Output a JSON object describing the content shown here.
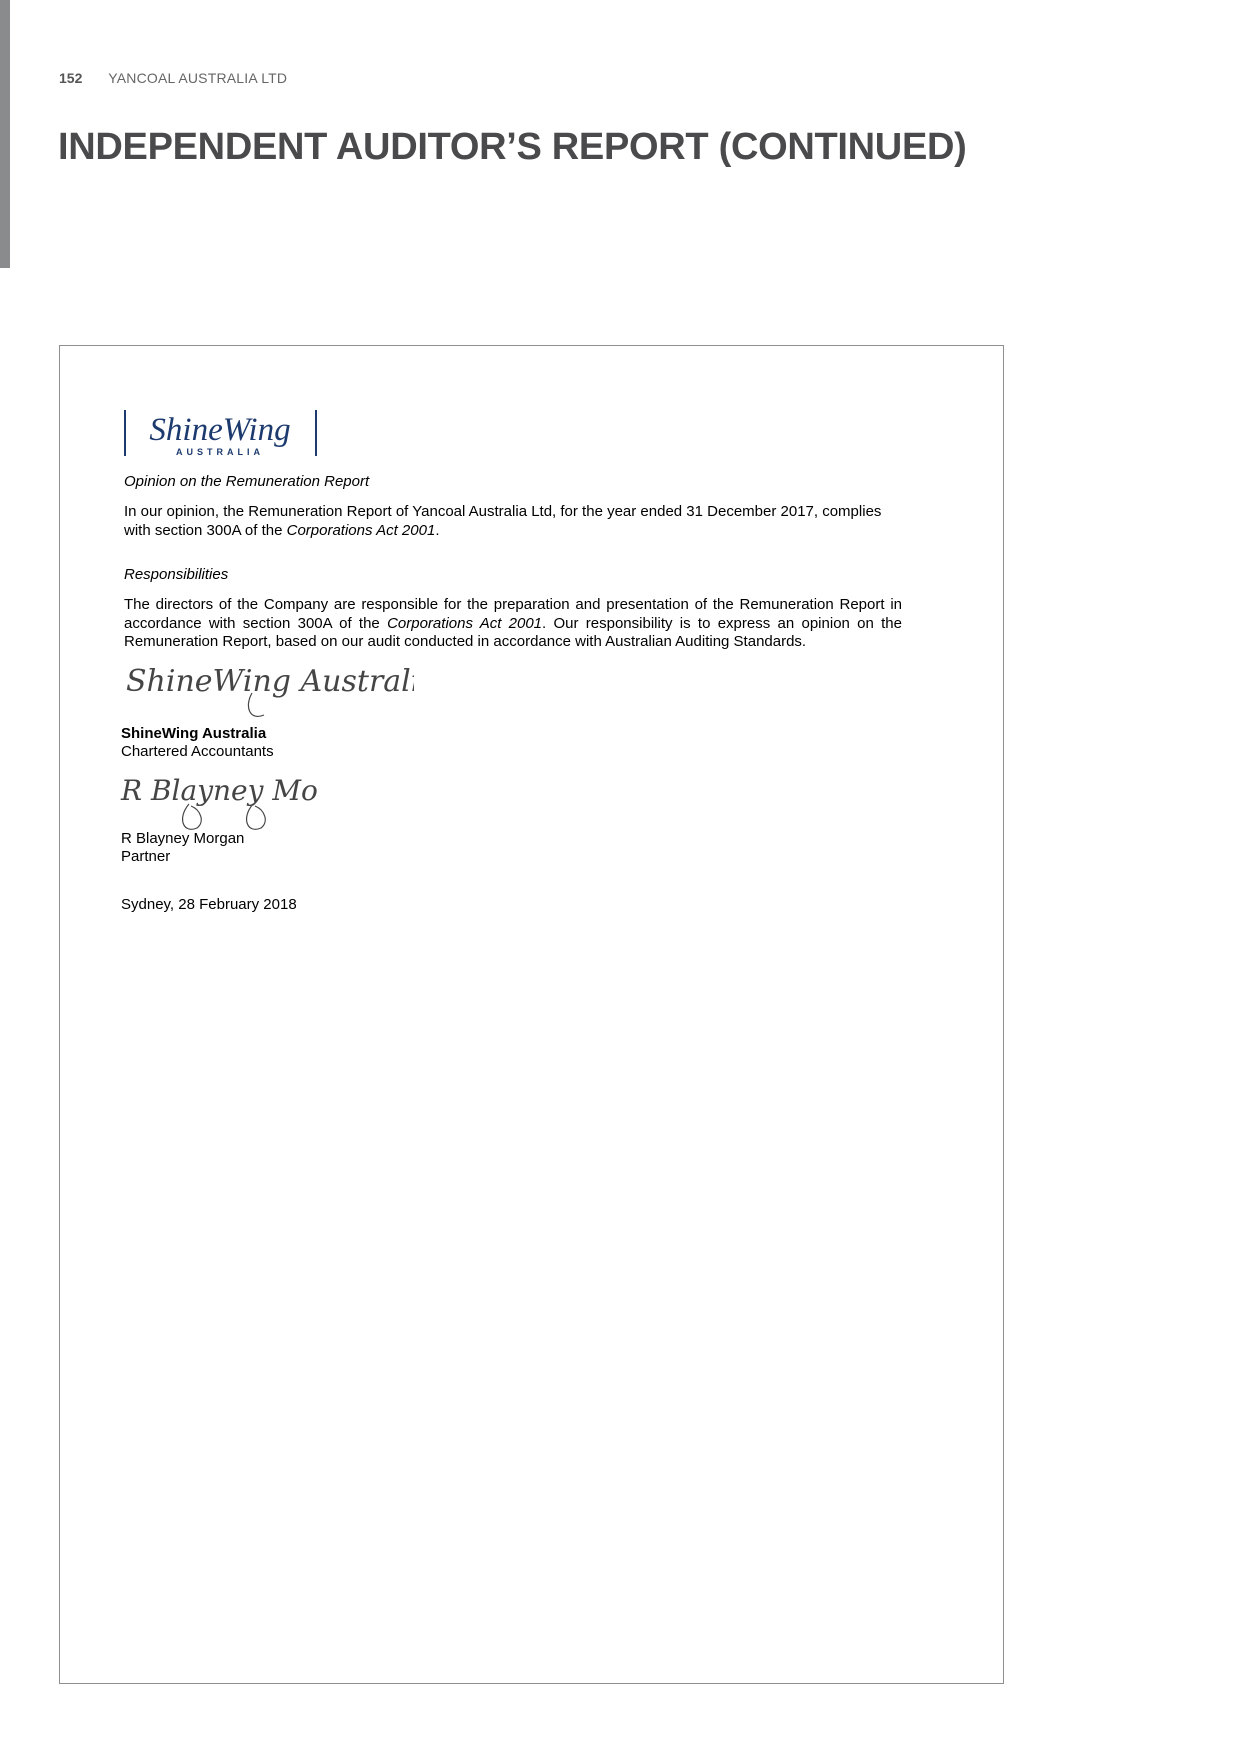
{
  "header": {
    "page_number": "152",
    "company": "YANCOAL AUSTRALIA LTD"
  },
  "title": "INDEPENDENT AUDITOR’S REPORT (CONTINUED)",
  "logo": {
    "name": "ShineWing",
    "sub": "AUSTRALIA",
    "color": "#1c3a6e"
  },
  "opinion": {
    "heading": "Opinion on the Remuneration Report",
    "text_1": "In our opinion, the Remuneration Report of Yancoal Australia Ltd, for the year ended 31 December 2017, complies with section 300A of the ",
    "act": "Corporations Act 2001",
    "text_2": "."
  },
  "responsibilities": {
    "heading": "Responsibilities",
    "text_1": "The directors of the Company are responsible for the preparation and presentation of the Remuneration Report in accordance with section 300A of the ",
    "act": "Corporations Act 2001",
    "text_2": ". Our responsibility is to express an opinion on the Remuneration Report, based on our audit conducted in accordance with Australian Auditing Standards."
  },
  "firm_signature": "ShineWing Australia",
  "firm": {
    "name": "ShineWing Australia",
    "role": "Chartered Accountants"
  },
  "partner_signature": "R Blayney Morgan",
  "partner": {
    "name": "R Blayney Morgan",
    "role": "Partner"
  },
  "place_date": "Sydney, 28 February 2018"
}
